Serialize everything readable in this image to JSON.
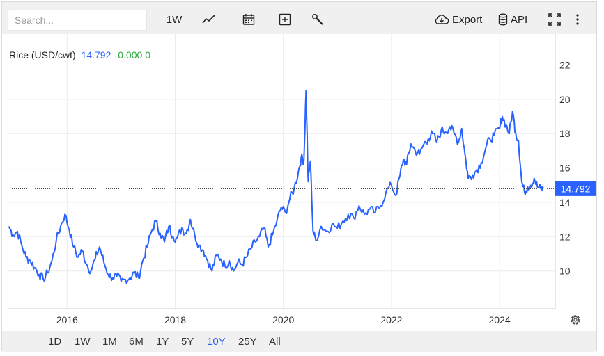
{
  "toolbar": {
    "search_placeholder": "Search...",
    "interval_label": "1W",
    "line_icon": "line-chart-icon",
    "calendar_icon": "calendar-icon",
    "compare_icon": "add-compare-icon",
    "tools_icon": "wrench-icon",
    "export_label": "Export",
    "api_label": "API",
    "fullscreen_icon": "fullscreen-icon",
    "more_icon": "more-vertical-icon"
  },
  "legend": {
    "symbol": "Rice (USD/cwt)",
    "price": "14.792",
    "change": "0.000",
    "change_pct": "0"
  },
  "price_badge": "14.792",
  "settings_icon": "gear-icon",
  "ranges": [
    "1D",
    "1W",
    "1M",
    "6M",
    "1Y",
    "5Y",
    "10Y",
    "25Y",
    "All"
  ],
  "active_range": "10Y",
  "colors": {
    "line": "#2962ff",
    "badge": "#2962ff",
    "positive": "#2eab3f",
    "toolbar_bg": "#f0f0f0"
  },
  "chart_data": {
    "type": "line",
    "title": "Rice (USD/cwt)",
    "xlabel": "",
    "ylabel": "",
    "ylim": [
      7.8,
      23.8
    ],
    "xlim": [
      2014.9,
      2025.03
    ],
    "y_ticks": [
      10,
      12,
      14,
      16,
      18,
      20,
      22
    ],
    "x_ticks": [
      2016,
      2018,
      2020,
      2022,
      2024
    ],
    "last_value": 14.792,
    "grid": true,
    "series": [
      {
        "points": [
          [
            2014.92,
            12.6
          ],
          [
            2015.0,
            12.1
          ],
          [
            2015.08,
            12.3
          ],
          [
            2015.16,
            11.5
          ],
          [
            2015.24,
            10.8
          ],
          [
            2015.32,
            10.6
          ],
          [
            2015.4,
            10.2
          ],
          [
            2015.48,
            9.8
          ],
          [
            2015.56,
            9.5
          ],
          [
            2015.64,
            9.9
          ],
          [
            2015.72,
            10.6
          ],
          [
            2015.8,
            11.8
          ],
          [
            2015.88,
            12.6
          ],
          [
            2015.96,
            13.3
          ],
          [
            2016.04,
            12.4
          ],
          [
            2016.12,
            11.4
          ],
          [
            2016.2,
            10.8
          ],
          [
            2016.28,
            11.2
          ],
          [
            2016.36,
            10.4
          ],
          [
            2016.44,
            10.0
          ],
          [
            2016.52,
            10.7
          ],
          [
            2016.6,
            11.4
          ],
          [
            2016.68,
            10.5
          ],
          [
            2016.76,
            9.8
          ],
          [
            2016.84,
            9.6
          ],
          [
            2016.92,
            9.7
          ],
          [
            2017.0,
            9.4
          ],
          [
            2017.08,
            9.5
          ],
          [
            2017.16,
            9.6
          ],
          [
            2017.24,
            9.9
          ],
          [
            2017.32,
            9.6
          ],
          [
            2017.4,
            10.6
          ],
          [
            2017.48,
            11.4
          ],
          [
            2017.56,
            12.3
          ],
          [
            2017.64,
            12.9
          ],
          [
            2017.72,
            12.2
          ],
          [
            2017.8,
            11.7
          ],
          [
            2017.88,
            12.6
          ],
          [
            2017.96,
            12.0
          ],
          [
            2018.04,
            11.9
          ],
          [
            2018.12,
            12.5
          ],
          [
            2018.2,
            12.2
          ],
          [
            2018.28,
            13.0
          ],
          [
            2018.36,
            12.1
          ],
          [
            2018.44,
            11.5
          ],
          [
            2018.52,
            11.2
          ],
          [
            2018.6,
            10.6
          ],
          [
            2018.68,
            10.0
          ],
          [
            2018.76,
            10.9
          ],
          [
            2018.84,
            10.7
          ],
          [
            2018.92,
            10.3
          ],
          [
            2019.0,
            10.6
          ],
          [
            2019.08,
            10.0
          ],
          [
            2019.16,
            10.5
          ],
          [
            2019.24,
            10.4
          ],
          [
            2019.32,
            10.8
          ],
          [
            2019.4,
            11.3
          ],
          [
            2019.48,
            11.7
          ],
          [
            2019.56,
            12.0
          ],
          [
            2019.64,
            12.5
          ],
          [
            2019.72,
            11.4
          ],
          [
            2019.8,
            12.1
          ],
          [
            2019.88,
            12.9
          ],
          [
            2019.96,
            13.7
          ],
          [
            2020.04,
            13.4
          ],
          [
            2020.12,
            14.2
          ],
          [
            2020.2,
            14.8
          ],
          [
            2020.28,
            15.8
          ],
          [
            2020.33,
            16.6
          ],
          [
            2020.38,
            16.4
          ],
          [
            2020.42,
            20.5
          ],
          [
            2020.46,
            15.2
          ],
          [
            2020.5,
            16.4
          ],
          [
            2020.55,
            12.3
          ],
          [
            2020.6,
            11.8
          ],
          [
            2020.7,
            12.6
          ],
          [
            2020.8,
            12.3
          ],
          [
            2020.9,
            12.7
          ],
          [
            2021.0,
            12.5
          ],
          [
            2021.1,
            12.9
          ],
          [
            2021.2,
            13.3
          ],
          [
            2021.3,
            13.1
          ],
          [
            2021.4,
            13.8
          ],
          [
            2021.5,
            13.3
          ],
          [
            2021.6,
            13.6
          ],
          [
            2021.7,
            13.4
          ],
          [
            2021.8,
            13.8
          ],
          [
            2021.9,
            14.6
          ],
          [
            2022.0,
            15.0
          ],
          [
            2022.08,
            14.4
          ],
          [
            2022.16,
            15.6
          ],
          [
            2022.22,
            16.5
          ],
          [
            2022.28,
            16.2
          ],
          [
            2022.36,
            17.4
          ],
          [
            2022.44,
            17.0
          ],
          [
            2022.52,
            16.8
          ],
          [
            2022.6,
            17.4
          ],
          [
            2022.68,
            17.7
          ],
          [
            2022.76,
            18.0
          ],
          [
            2022.84,
            17.5
          ],
          [
            2022.92,
            18.2
          ],
          [
            2023.0,
            18.1
          ],
          [
            2023.08,
            18.4
          ],
          [
            2023.16,
            18.0
          ],
          [
            2023.24,
            17.5
          ],
          [
            2023.3,
            18.3
          ],
          [
            2023.36,
            16.8
          ],
          [
            2023.42,
            15.4
          ],
          [
            2023.5,
            15.6
          ],
          [
            2023.58,
            15.9
          ],
          [
            2023.66,
            16.3
          ],
          [
            2023.74,
            17.1
          ],
          [
            2023.82,
            17.7
          ],
          [
            2023.9,
            17.9
          ],
          [
            2024.0,
            18.3
          ],
          [
            2024.05,
            19.0
          ],
          [
            2024.12,
            18.5
          ],
          [
            2024.18,
            18.0
          ],
          [
            2024.24,
            19.3
          ],
          [
            2024.3,
            18.0
          ],
          [
            2024.35,
            17.6
          ],
          [
            2024.41,
            15.2
          ],
          [
            2024.46,
            14.6
          ],
          [
            2024.52,
            14.9
          ],
          [
            2024.58,
            15.0
          ],
          [
            2024.64,
            15.4
          ],
          [
            2024.7,
            14.9
          ],
          [
            2024.76,
            14.8
          ],
          [
            2024.81,
            14.792
          ]
        ]
      }
    ]
  }
}
